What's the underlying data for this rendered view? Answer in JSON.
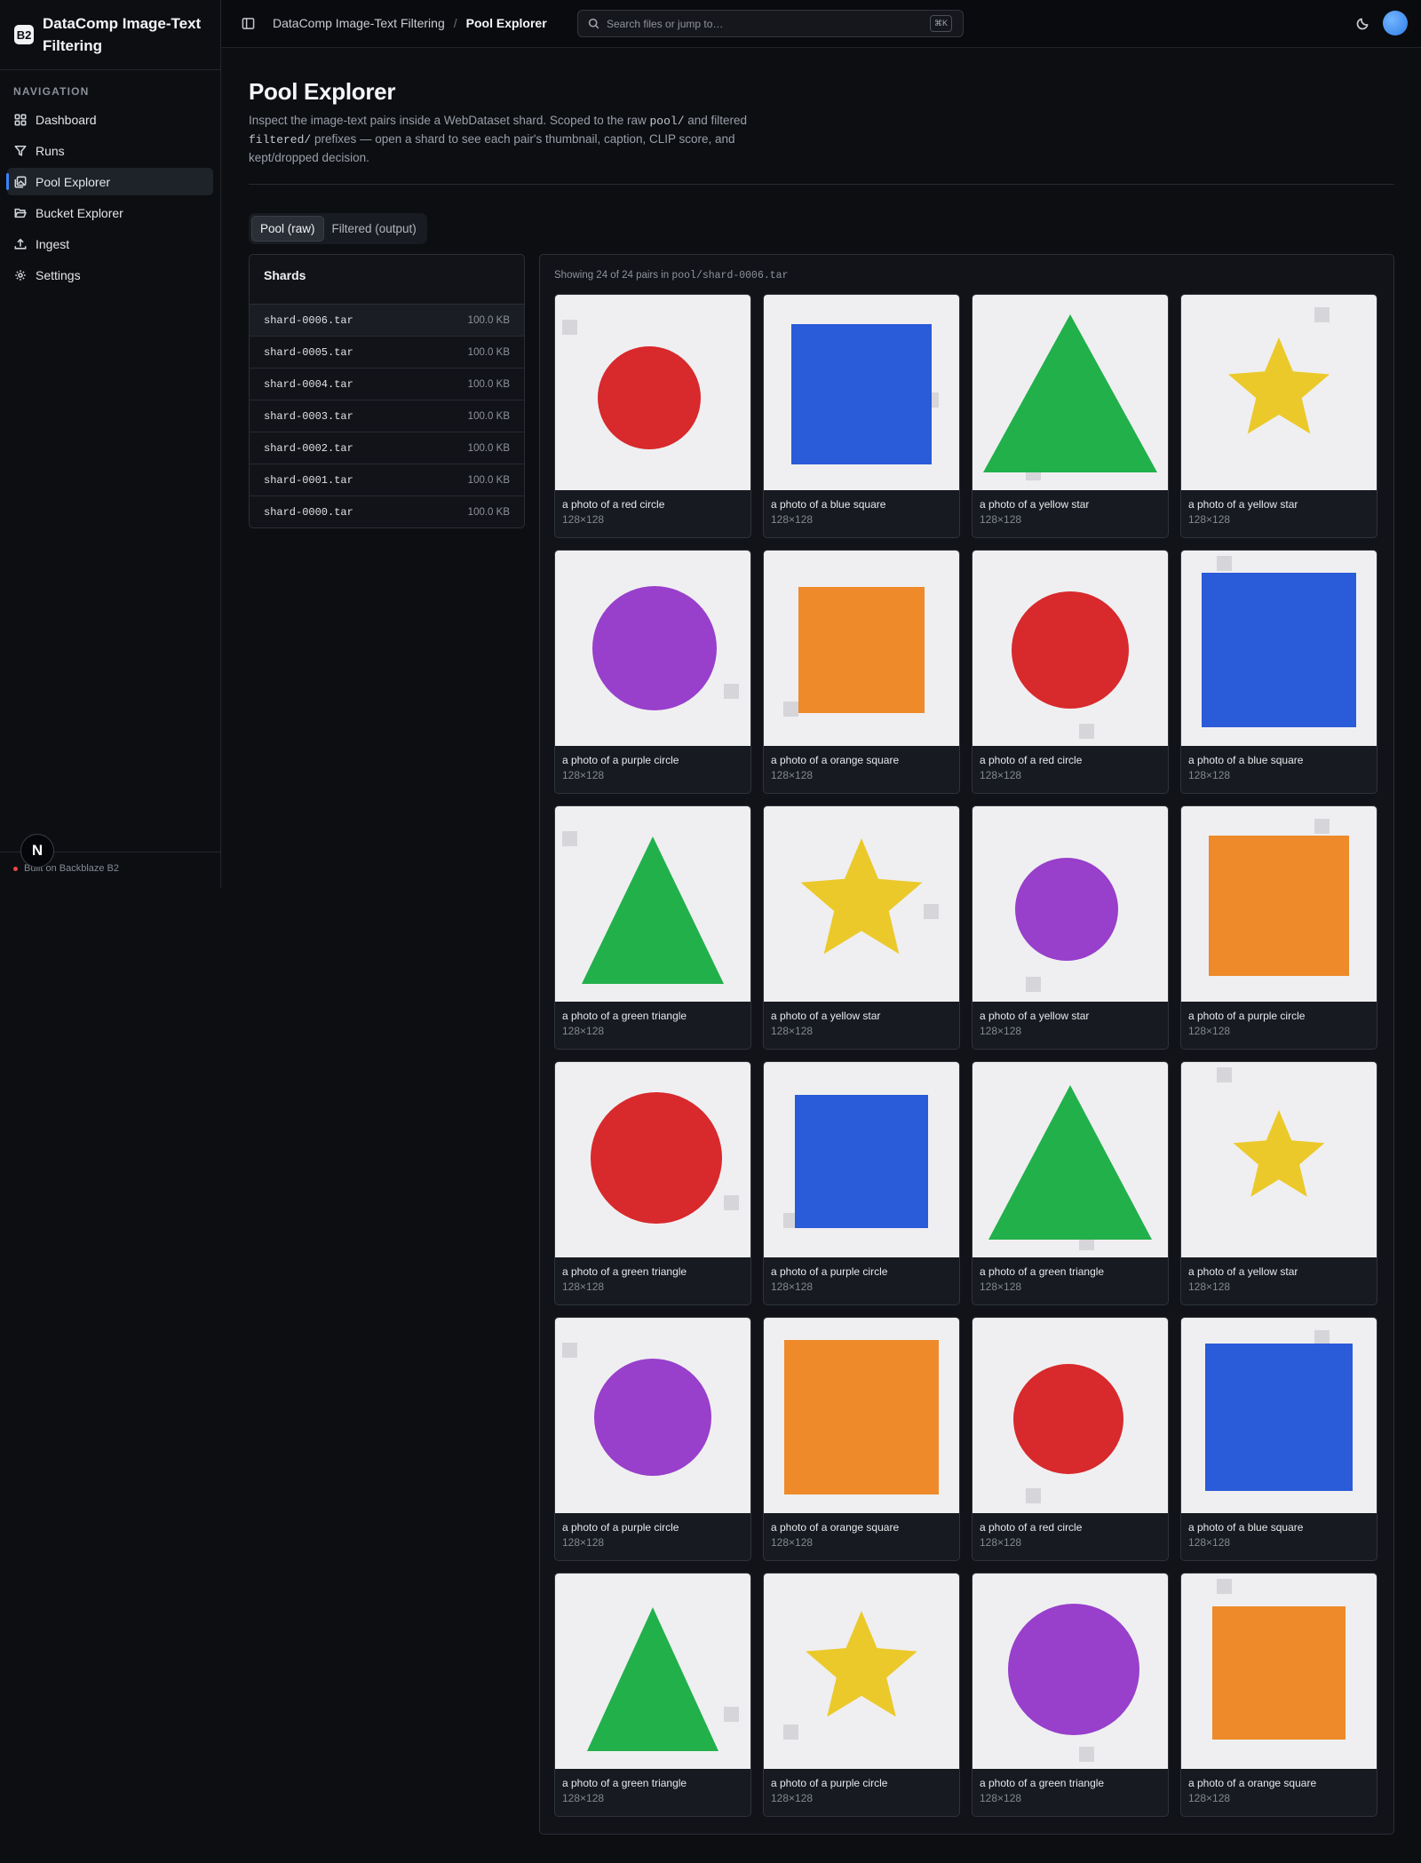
{
  "brand": {
    "logo": "B2",
    "name": "DataComp Image-Text Filtering"
  },
  "sidebar": {
    "heading": "NAVIGATION",
    "items": [
      {
        "label": "Dashboard",
        "icon": "dashboard-icon"
      },
      {
        "label": "Runs",
        "icon": "filter-icon"
      },
      {
        "label": "Pool Explorer",
        "icon": "images-icon",
        "active": true
      },
      {
        "label": "Bucket Explorer",
        "icon": "folder-open-icon"
      },
      {
        "label": "Ingest",
        "icon": "upload-icon"
      },
      {
        "label": "Settings",
        "icon": "gear-icon"
      }
    ],
    "footer": "Built on Backblaze B2",
    "badge": "N"
  },
  "topbar": {
    "breadcrumb": [
      "DataComp Image-Text Filtering",
      "Pool Explorer"
    ],
    "breadcrumb_sep": "/",
    "search_placeholder": "Search files or jump to…",
    "search_kbd": "⌘K"
  },
  "page": {
    "title": "Pool Explorer",
    "desc_1": "Inspect the image-text pairs inside a WebDataset shard. Scoped to the raw ",
    "desc_code_1": "pool/",
    "desc_2": " and filtered ",
    "desc_code_2": "filtered/",
    "desc_3": " prefixes — open a shard to see each pair's thumbnail, caption, CLIP score, and kept/dropped decision."
  },
  "tabs": [
    {
      "label": "Pool (raw)",
      "active": true
    },
    {
      "label": "Filtered (output)",
      "active": false
    }
  ],
  "shards": {
    "title": "Shards",
    "items": [
      {
        "name": "shard-0006.tar",
        "size": "100.0 KB",
        "selected": true
      },
      {
        "name": "shard-0005.tar",
        "size": "100.0 KB"
      },
      {
        "name": "shard-0004.tar",
        "size": "100.0 KB"
      },
      {
        "name": "shard-0003.tar",
        "size": "100.0 KB"
      },
      {
        "name": "shard-0002.tar",
        "size": "100.0 KB"
      },
      {
        "name": "shard-0001.tar",
        "size": "100.0 KB"
      },
      {
        "name": "shard-0000.tar",
        "size": "100.0 KB"
      }
    ]
  },
  "grid": {
    "caption_prefix": "Showing 24 of 24 pairs in ",
    "caption_path": "pool/shard-0006.tar",
    "colors": {
      "red": "#d8292c",
      "blue": "#2a5bd8",
      "green": "#22b04b",
      "yellow": "#ebc92a",
      "purple": "#983fcb",
      "orange": "#ee8a2a"
    },
    "pairs": [
      {
        "shape": "circle",
        "color": "red",
        "caption": "a photo of a red circle",
        "dims": "128×128"
      },
      {
        "shape": "square",
        "color": "blue",
        "caption": "a photo of a blue square",
        "dims": "128×128"
      },
      {
        "shape": "triangle",
        "color": "green",
        "caption": "a photo of a yellow star",
        "dims": "128×128"
      },
      {
        "shape": "star",
        "color": "yellow",
        "caption": "a photo of a yellow star",
        "dims": "128×128"
      },
      {
        "shape": "circle",
        "color": "purple",
        "caption": "a photo of a purple circle",
        "dims": "128×128"
      },
      {
        "shape": "square",
        "color": "orange",
        "caption": "a photo of a orange square",
        "dims": "128×128"
      },
      {
        "shape": "circle",
        "color": "red",
        "caption": "a photo of a red circle",
        "dims": "128×128"
      },
      {
        "shape": "square",
        "color": "blue",
        "caption": "a photo of a blue square",
        "dims": "128×128"
      },
      {
        "shape": "triangle",
        "color": "green",
        "caption": "a photo of a green triangle",
        "dims": "128×128"
      },
      {
        "shape": "star",
        "color": "yellow",
        "caption": "a photo of a yellow star",
        "dims": "128×128"
      },
      {
        "shape": "circle",
        "color": "purple",
        "caption": "a photo of a yellow star",
        "dims": "128×128"
      },
      {
        "shape": "square",
        "color": "orange",
        "caption": "a photo of a purple circle",
        "dims": "128×128"
      },
      {
        "shape": "circle",
        "color": "red",
        "caption": "a photo of a green triangle",
        "dims": "128×128"
      },
      {
        "shape": "square",
        "color": "blue",
        "caption": "a photo of a purple circle",
        "dims": "128×128"
      },
      {
        "shape": "triangle",
        "color": "green",
        "caption": "a photo of a green triangle",
        "dims": "128×128"
      },
      {
        "shape": "star",
        "color": "yellow",
        "caption": "a photo of a yellow star",
        "dims": "128×128"
      },
      {
        "shape": "circle",
        "color": "purple",
        "caption": "a photo of a purple circle",
        "dims": "128×128"
      },
      {
        "shape": "square",
        "color": "orange",
        "caption": "a photo of a orange square",
        "dims": "128×128"
      },
      {
        "shape": "circle",
        "color": "red",
        "caption": "a photo of a red circle",
        "dims": "128×128"
      },
      {
        "shape": "square",
        "color": "blue",
        "caption": "a photo of a blue square",
        "dims": "128×128"
      },
      {
        "shape": "triangle",
        "color": "green",
        "caption": "a photo of a green triangle",
        "dims": "128×128"
      },
      {
        "shape": "star",
        "color": "yellow",
        "caption": "a photo of a purple circle",
        "dims": "128×128"
      },
      {
        "shape": "circle",
        "color": "purple",
        "caption": "a photo of a green triangle",
        "dims": "128×128"
      },
      {
        "shape": "square",
        "color": "orange",
        "caption": "a photo of a orange square",
        "dims": "128×128"
      }
    ]
  }
}
